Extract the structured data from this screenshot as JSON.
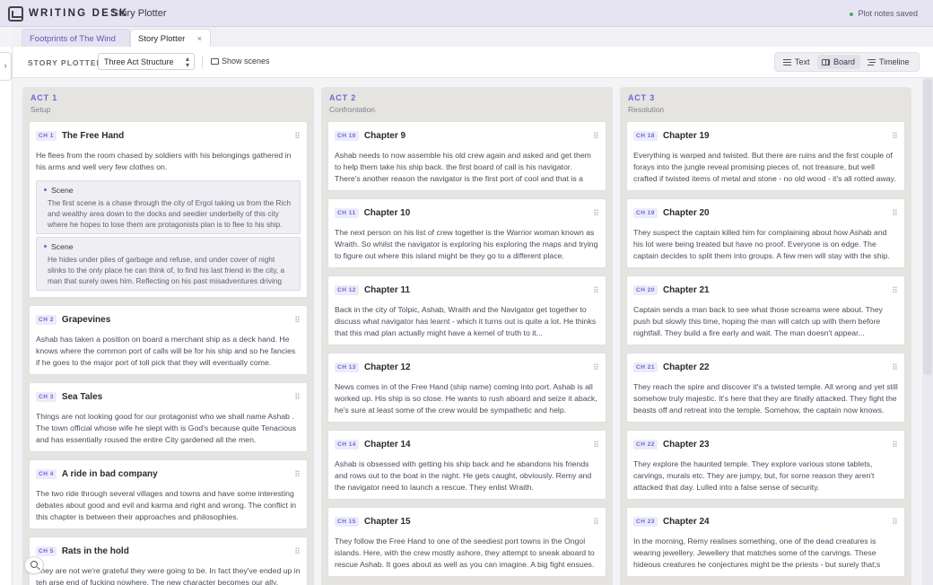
{
  "app": {
    "logo": "WRITING DESK",
    "page": "Story Plotter",
    "save_status": "Plot notes saved"
  },
  "tabs": [
    {
      "label": "Footprints of The Wind",
      "active": false
    },
    {
      "label": "Story Plotter",
      "active": true,
      "close": "×"
    }
  ],
  "toolbar": {
    "label": "STORY PLOTTER",
    "structure_selected": "Three Act Structure",
    "show_scenes": "Show scenes",
    "views": [
      {
        "label": "Text",
        "icon": "lines-icon"
      },
      {
        "label": "Board",
        "icon": "board-icon",
        "active": true
      },
      {
        "label": "Timeline",
        "icon": "timeline-icon"
      }
    ]
  },
  "colors": {
    "accent": "#6a66d9",
    "status_dot": "#4aa86a"
  },
  "acts": [
    {
      "title": "ACT 1",
      "subtitle": "Setup",
      "chapters": [
        {
          "badge": "CH 1",
          "title": "The Free Hand",
          "body": "He flees from the room chased by soldiers with his belongings gathered in his arms and well very few clothes on.",
          "scenes": [
            {
              "label": "Scene",
              "text": "The first scene is a chase through the city of Ergol taking us from the Rich and wealthy area down to the docks and seedier underbelly of this city where he hopes to lose them are protagonists plan is to flee to his ship."
            },
            {
              "label": "Scene",
              "text": "He hides under piles of garbage and refuse, and under cover of night slinks to the only place he can think of, to find his last friend in the city, a man that surely owes him. Reflecting on his past misadventures driving him forward."
            }
          ]
        },
        {
          "badge": "CH 2",
          "title": "Grapevines",
          "body": "Ashab has taken a position on board a merchant ship as a deck hand. He knows where the common port of calls will be for his ship and so he fancies if he goes to the major port of toll pick that they will eventually come."
        },
        {
          "badge": "CH 3",
          "title": "Sea Tales",
          "body": "Things are not looking good for our protagonist who we shall name Ashab . The town official whose wife he slept with is God's because quite Tenacious and has essentially roused the entire City gardened all the men."
        },
        {
          "badge": "CH 4",
          "title": "A ride in bad company",
          "body": "The two ride through several villages and towns and have some interesting debates about good and evil and karma and right and wrong. The conflict in this chapter is between their approaches and philosophies."
        },
        {
          "badge": "CH 5",
          "title": "Rats in the hold",
          "body": "They are not we're grateful they were going to be. In fact they've ended up in teh arse end of fucking nowhere. The new character becomes our ally."
        }
      ]
    },
    {
      "title": "ACT 2",
      "subtitle": "Confrontation",
      "chapters": [
        {
          "badge": "CH 10",
          "title": "Chapter 9",
          "body": "Ashab needs to now assemble his old crew again and asked and get them to help them take his ship back. the first board of call is his navigator. There's another reason the navigator is the first port of cool and that is a story."
        },
        {
          "badge": "CH 11",
          "title": "Chapter 10",
          "body": "The next person on his list of crew together is the Warrior woman known as Wraith. So whilst the navigator is exploring his exploring the maps and trying to figure out where this island might be they go to a different place."
        },
        {
          "badge": "CH 12",
          "title": "Chapter 11",
          "body": "Back in the city of Tolpic, Ashab, Wraith and the Navigator get together to discuss what navigator has learnt - which it turns out is quite a lot. He thinks that this mad plan actually might have a kernel of truth to it..."
        },
        {
          "badge": "CH 13",
          "title": "Chapter 12",
          "body": "News comes in of the Free Hand (ship name) coming into port. Ashab is all worked up. His ship is so close. He wants to rush aboard and seize it aback, he's sure at least some of the crew would be sympathetic and help."
        },
        {
          "badge": "CH 14",
          "title": "Chapter 14",
          "body": "Ashab is obsessed with getting his ship back and he abandons his friends and rows out to the boat in the night. He gets caught, obviously. Remy and the navigator need to launch a rescue. They enlist Wraith."
        },
        {
          "badge": "CH 15",
          "title": "Chapter 15",
          "body": "They follow the Free Hand to one of the seediest port towns in the Ongol islands. Here, with the crew mostly ashore, they attempt to sneak aboard to rescue Ashab. It goes about as well as you can imagine. A big fight ensues."
        }
      ]
    },
    {
      "title": "ACT 3",
      "subtitle": "Resolution",
      "chapters": [
        {
          "badge": "CH 18",
          "title": "Chapter 19",
          "body": "Everything is warped and twisted. But there are ruins and the first couple of forays into the jungle reveal promising pieces of, not treasure, but well crafted if twisted items of metal and stone - no old wood - it's all rotted away."
        },
        {
          "badge": "CH 19",
          "title": "Chapter 20",
          "body": "They suspect the captain killed him for complaining about how Ashab and his lot were being treated but have no proof. Everyone is on edge. The captain decides to split them into groups. A few men will stay with the ship."
        },
        {
          "badge": "CH 20",
          "title": "Chapter 21",
          "body": "Captain sends a man back to see what those screams were about. They push but slowly this time, hoping the man will catch up with them before nightfall. They build a fire early and wait. The man doesn't appear..."
        },
        {
          "badge": "CH 21",
          "title": "Chapter 22",
          "body": "They reach the spire and discover it's a twisted temple. All wrong and yet still somehow truly majestic. It's here that they are finally attacked. They fight the beasts off and retreat into the temple. Somehow, the captain now knows."
        },
        {
          "badge": "CH 22",
          "title": "Chapter 23",
          "body": "They explore the haunted temple. They explore various stone tablets, carvings, murals etc. They are jumpy, but, for some reason they aren't attacked that day. Lulled into a false sense of security."
        },
        {
          "badge": "CH 23",
          "title": "Chapter 24",
          "body": "In the morning, Remy realises something, one of the dead creatures is wearing jewellery. Jewellery that matches some of the carvings. These hideous creatures he conjectures might be the priests - but surely that;s nonsense."
        }
      ]
    }
  ]
}
